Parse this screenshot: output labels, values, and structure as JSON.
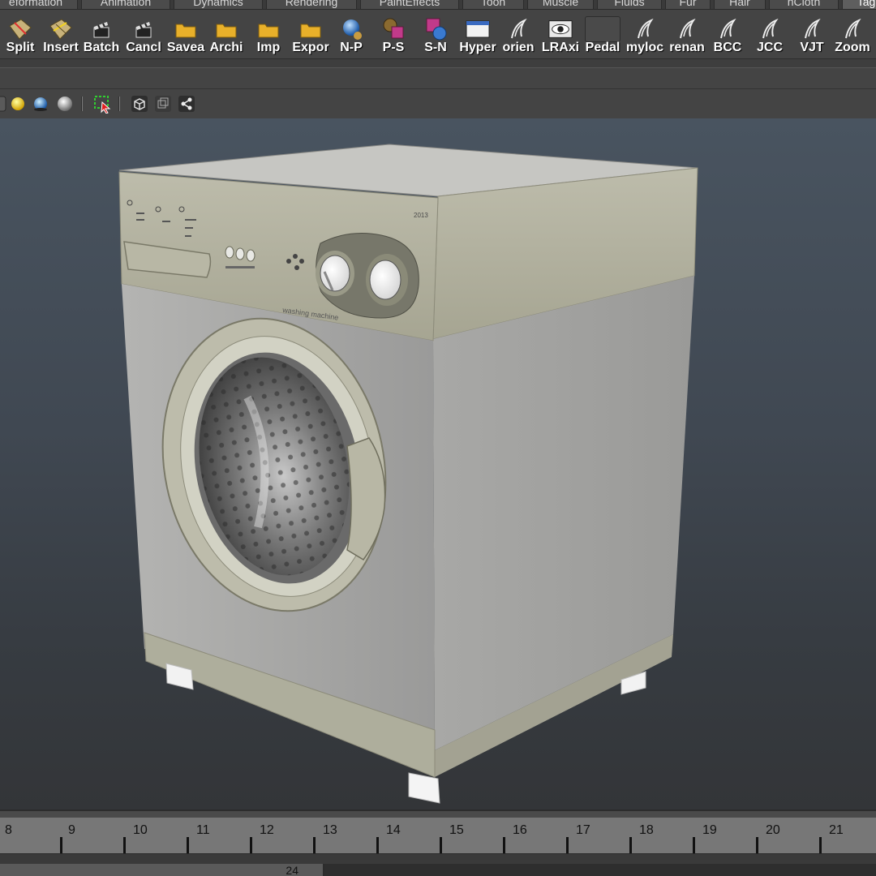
{
  "shelf_tabs": [
    {
      "label": "eformation"
    },
    {
      "label": "Animation"
    },
    {
      "label": "Dynamics"
    },
    {
      "label": "Rendering"
    },
    {
      "label": "PaintEffects"
    },
    {
      "label": "Toon"
    },
    {
      "label": "Muscle"
    },
    {
      "label": "Fluids"
    },
    {
      "label": "Fur"
    },
    {
      "label": "Hair"
    },
    {
      "label": "nCloth"
    },
    {
      "label": "Tag"
    }
  ],
  "shelf_buttons": [
    {
      "label": "Split",
      "icon": "split-polygon-icon"
    },
    {
      "label": "Insert",
      "icon": "insert-edge-loop-icon"
    },
    {
      "label": "Batch",
      "icon": "clapper-icon"
    },
    {
      "label": "Cancl",
      "icon": "clapper-icon"
    },
    {
      "label": "Savea",
      "icon": "folder-icon"
    },
    {
      "label": "Archi",
      "icon": "folder-icon"
    },
    {
      "label": "Imp",
      "icon": "folder-icon"
    },
    {
      "label": "Expor",
      "icon": "folder-icon"
    },
    {
      "label": "N-P",
      "icon": "sphere-icon"
    },
    {
      "label": "P-S",
      "icon": "globe-cube-icon"
    },
    {
      "label": "S-N",
      "icon": "cube-sphere-icon"
    },
    {
      "label": "Hyper",
      "icon": "window-icon"
    },
    {
      "label": "orien",
      "icon": "mel-script-icon"
    },
    {
      "label": "LRAxi",
      "icon": "eye-icon"
    },
    {
      "label": "Pedal",
      "icon": "blank-icon"
    },
    {
      "label": "myloc",
      "icon": "mel-script-icon"
    },
    {
      "label": "renan",
      "icon": "mel-script-icon"
    },
    {
      "label": "BCC",
      "icon": "mel-script-icon"
    },
    {
      "label": "JCC",
      "icon": "mel-script-icon"
    },
    {
      "label": "VJT",
      "icon": "mel-script-icon"
    },
    {
      "label": "Zoom",
      "icon": "mel-script-icon"
    }
  ],
  "panel_toolbar": [
    {
      "icon": "lighting-default-icon"
    },
    {
      "icon": "all-lights-icon"
    },
    {
      "icon": "shaded-sphere-icon"
    },
    {
      "icon": "gray-sphere-icon"
    },
    {
      "icon": "isolate-select-icon"
    },
    {
      "icon": "xray-cube-icon"
    },
    {
      "icon": "wireframe-cube-icon"
    },
    {
      "icon": "share-nodes-icon"
    }
  ],
  "viewport": {
    "model": "washing machine",
    "panel_text_year": "2013",
    "panel_text_brand": "washing machine",
    "colors": {
      "body_side": "#a2a2a1",
      "body_front": "#9c9c9b",
      "trim": "#b3b29e",
      "top": "#c3c3bf"
    }
  },
  "timeline": {
    "frames": [
      "8",
      "9",
      "10",
      "11",
      "12",
      "13",
      "14",
      "15",
      "16",
      "17",
      "18",
      "19",
      "20",
      "21"
    ],
    "range_end": "24"
  }
}
